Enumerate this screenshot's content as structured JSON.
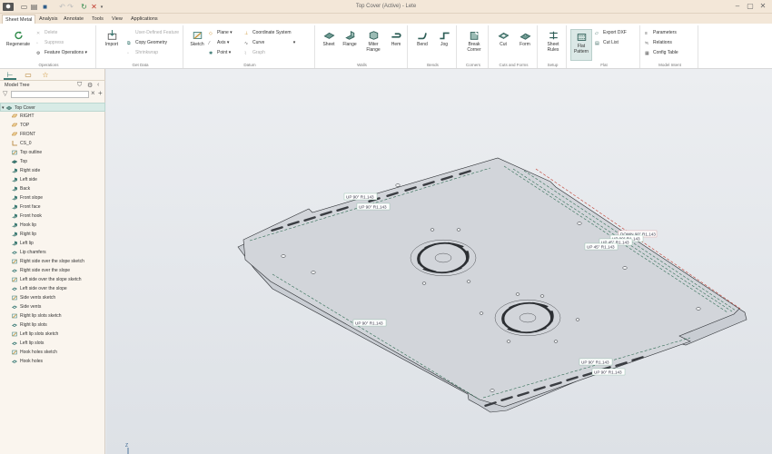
{
  "title_bar": {
    "title": "Top Cover (Active) - Lete"
  },
  "menu": {
    "tabs": [
      "Sheet Metal",
      "Analysis",
      "Annotate",
      "Tools",
      "View",
      "Applications"
    ],
    "active": "Sheet Metal"
  },
  "ribbon": {
    "operations": {
      "label": "Operations",
      "regenerate": "Regenerate",
      "delete": "Delete",
      "suppress": "Suppress",
      "feature_operations": "Feature Operations"
    },
    "get_data": {
      "label": "Get Data",
      "import": "Import",
      "user_defined": "User-Defined Feature",
      "copy_geometry": "Copy Geometry",
      "shrinkwrap": "Shrinkwrap"
    },
    "datum": {
      "label": "Datum",
      "sketch": "Sketch",
      "plane": "Plane",
      "axis": "Axis",
      "point": "Point",
      "coordinate_system": "Coordinate System",
      "curve": "Curve",
      "graph": "Graph"
    },
    "walls": {
      "label": "Walls",
      "sheet": "Sheet",
      "flange": "Flange",
      "miter_flange": "Miter Flange",
      "hem": "Hem"
    },
    "bends": {
      "label": "Bends",
      "bend": "Bend",
      "jog": "Jog"
    },
    "corners": {
      "label": "Corners",
      "break_corner": "Break Corner"
    },
    "cuts": {
      "label": "Cuts and Forms",
      "cut": "Cut",
      "form": "Form"
    },
    "setup": {
      "label": "Setup",
      "sheet_rules": "Sheet Rules"
    },
    "flat": {
      "label": "Flat",
      "flat_pattern": "Flat Pattern",
      "export_dxf": "Export DXF",
      "cut_list": "Cut List"
    },
    "model_intent": {
      "label": "Model Intent",
      "parameters": "Parameters",
      "relations": "Relations",
      "config_table": "Config Table"
    }
  },
  "panel": {
    "header": "Model Tree",
    "filter_placeholder": "",
    "tree": [
      {
        "label": "Top Cover",
        "icon": "part-icon",
        "level": 0
      },
      {
        "label": "RIGHT",
        "icon": "plane-icon",
        "level": 1
      },
      {
        "label": "TOP",
        "icon": "plane-icon",
        "level": 1
      },
      {
        "label": "FRONT",
        "icon": "plane-icon",
        "level": 1
      },
      {
        "label": "CS_0",
        "icon": "csys-icon",
        "level": 1
      },
      {
        "label": "Top outline",
        "icon": "sketch-icon",
        "level": 1
      },
      {
        "label": "Top",
        "icon": "sheet-icon",
        "level": 1
      },
      {
        "label": "Right side",
        "icon": "flange-icon",
        "level": 1
      },
      {
        "label": "Left side",
        "icon": "flange-icon",
        "level": 1
      },
      {
        "label": "Back",
        "icon": "flange-icon",
        "level": 1
      },
      {
        "label": "Front slope",
        "icon": "flange-icon",
        "level": 1
      },
      {
        "label": "Front face",
        "icon": "flange-icon",
        "level": 1
      },
      {
        "label": "Front hook",
        "icon": "flange-icon",
        "level": 1
      },
      {
        "label": "Hook lip",
        "icon": "flange-icon",
        "level": 1
      },
      {
        "label": "Right lip",
        "icon": "flange-icon",
        "level": 1
      },
      {
        "label": "Left lip",
        "icon": "flange-icon",
        "level": 1
      },
      {
        "label": "Lip chamfers",
        "icon": "cut-icon",
        "level": 1
      },
      {
        "label": "Right side over the slope sketch",
        "icon": "sketch-icon",
        "level": 1
      },
      {
        "label": "Right side over the slope",
        "icon": "cut-icon",
        "level": 1
      },
      {
        "label": "Left side over the slope sketch",
        "icon": "sketch-icon",
        "level": 1
      },
      {
        "label": "Left side over the slope",
        "icon": "cut-icon",
        "level": 1
      },
      {
        "label": "Side vents sketch",
        "icon": "sketch-icon",
        "level": 1
      },
      {
        "label": "Side vents",
        "icon": "cut-icon",
        "level": 1
      },
      {
        "label": "Right lip slots sketch",
        "icon": "sketch-icon",
        "level": 1
      },
      {
        "label": "Right lip slots",
        "icon": "cut-icon",
        "level": 1
      },
      {
        "label": "Left lip slots sketch",
        "icon": "sketch-icon",
        "level": 1
      },
      {
        "label": "Left lip slots",
        "icon": "cut-icon",
        "level": 1
      },
      {
        "label": "Hook holes sketch",
        "icon": "sketch-icon",
        "level": 1
      },
      {
        "label": "Hook holes",
        "icon": "cut-icon",
        "level": 1
      }
    ]
  },
  "viewport": {
    "bend_labels": [
      {
        "text": "UP 90° R1.143"
      },
      {
        "text": "UP 90° R1.143"
      },
      {
        "text": "DOWN 90° R1.143"
      },
      {
        "text": "UP 90° R1.143"
      },
      {
        "text": "UP 45° R1.143"
      },
      {
        "text": "UP 45° R1.143"
      },
      {
        "text": "UP 90° R1.143"
      },
      {
        "text": "UP 90° R1.143"
      },
      {
        "text": "UP 90° R1.143"
      }
    ],
    "axis_label": "Z",
    "colors": {
      "sheet": "#d2d5da",
      "bend_up": "#2e6b52",
      "bend_down": "#c0392b",
      "accent": "#3c7a73"
    }
  }
}
